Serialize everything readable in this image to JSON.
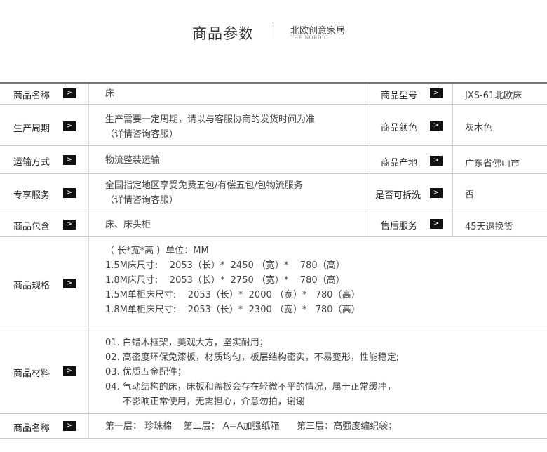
{
  "header": {
    "title": "商品参数",
    "brand": "北欧创意家居",
    "brand_en": "THE NORDIC"
  },
  "arrow_glyph": ">",
  "rows": [
    {
      "label": "商品名称",
      "value": "床",
      "label2": "商品型号",
      "value2": "JXS-61北欧床"
    },
    {
      "label": "生产周期",
      "value_lines": [
        "生产需要一定周期，请以与客服协商的发货时间为准",
        "（详情咨询客服）"
      ],
      "label2": "商品颜色",
      "value2": "灰木色"
    },
    {
      "label": "运输方式",
      "value": "物流整装运输",
      "label2": "商品产地",
      "value2": "广东省佛山市"
    },
    {
      "label": "专享服务",
      "value_lines": [
        "全国指定地区享受免费五包/有偿五包/包物流服务",
        "（详情咨询客服）"
      ],
      "label2": "是否可拆洗",
      "value2": "否"
    },
    {
      "label": "商品包含",
      "value": "床、床头柜",
      "label2": "售后服务",
      "value2": "45天退换货"
    },
    {
      "label": "商品规格",
      "value_lines": [
        "（ 长*宽*高 ）单位：MM",
        "1.5M床尺寸:    2053（长）*  2450 （宽）*    780（高）",
        "1.8M床尺寸:    2053（长）*  2750 （宽）*    780（高）",
        "1.5M单柜床尺寸:    2053（长）*  2000 （宽）*   780（高）",
        "1.8M单柜床尺寸:    2053（长）*  2300 （宽）*   780（高）"
      ]
    },
    {
      "label": "商品材料",
      "value_lines": [
        "01. 白蜡木框架，美观大方，坚实耐用；",
        "02. 高密度环保免漆板，材质均匀，板层结构密实，不易变形，性能稳定;",
        "03. 优质五金配件；",
        "04. 气动结构的床，床板和盖板会存在轻微不平的情况，属于正常缓冲，",
        "      不影响正常使用，无需担心，介意勿拍，谢谢"
      ]
    },
    {
      "label": "商品名称",
      "value": "第一层： 珍珠棉    第二层： A=A加强纸箱      第三层：高强度编织袋；"
    }
  ]
}
